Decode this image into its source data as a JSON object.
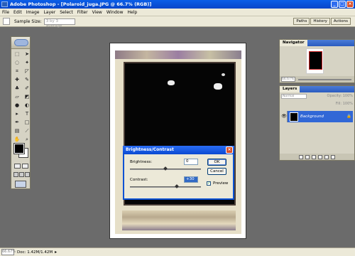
{
  "window": {
    "title": "Adobe Photoshop - [Polaroid_juga.JPG @ 66.7% (RGB)]"
  },
  "menu": [
    "File",
    "Edit",
    "Image",
    "Layer",
    "Select",
    "Filter",
    "View",
    "Window",
    "Help"
  ],
  "options_bar": {
    "label": "Sample Size:",
    "sample_size": "3 by 3 Average"
  },
  "palette_well": [
    "Paths",
    "History",
    "Actions"
  ],
  "navigator": {
    "tab": "Navigator",
    "zoom": "66.67%"
  },
  "layers_panel": {
    "tab": "Layers",
    "blend_mode": "Normal",
    "opacity_label": "Opacity:",
    "opacity": "100%",
    "fill_label": "Fill:",
    "fill": "100%",
    "layer_name": "Background"
  },
  "dialog": {
    "title": "Brightness/Contrast",
    "brightness_label": "Brightness:",
    "brightness_value": "0",
    "contrast_label": "Contrast:",
    "contrast_value": "+30",
    "ok_label": "OK",
    "cancel_label": "Cancel",
    "preview_label": "Preview",
    "preview_checked": true
  },
  "status": {
    "zoom": "66.67%",
    "doc": "Doc: 1.42M/1.42M"
  }
}
